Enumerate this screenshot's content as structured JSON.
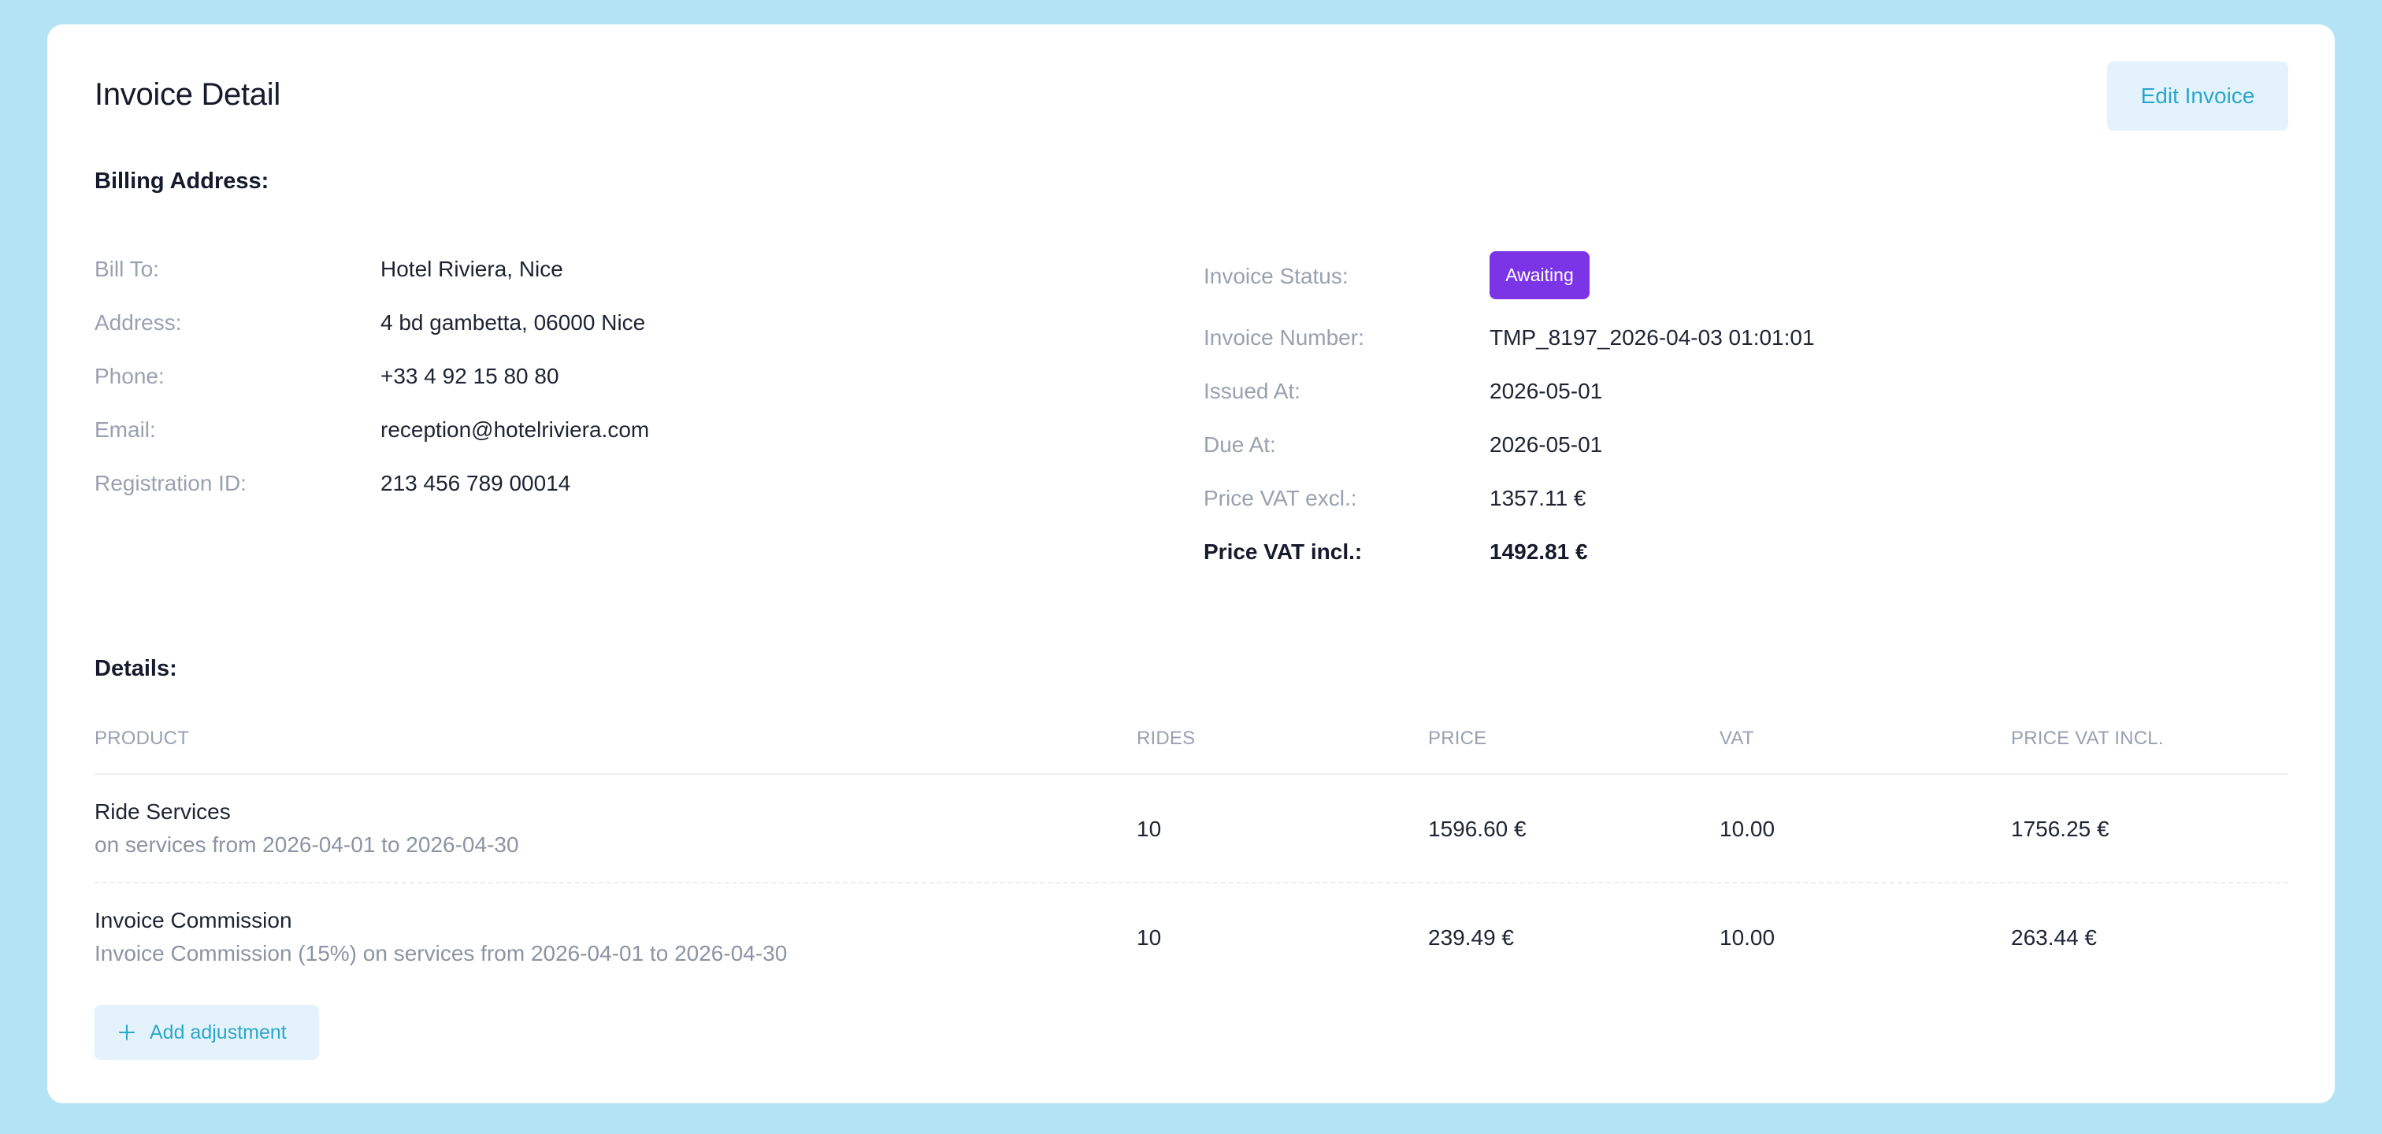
{
  "header": {
    "title": "Invoice Detail",
    "edit_label": "Edit Invoice"
  },
  "billing": {
    "heading": "Billing Address:",
    "rows": [
      {
        "label": "Bill To:",
        "value": "Hotel Riviera, Nice"
      },
      {
        "label": "Address:",
        "value": "4 bd gambetta, 06000 Nice"
      },
      {
        "label": "Phone:",
        "value": "+33 4 92 15 80 80"
      },
      {
        "label": "Email:",
        "value": "reception@hotelriviera.com"
      },
      {
        "label": "Registration ID:",
        "value": "213 456 789 00014"
      }
    ]
  },
  "invoice": {
    "status_label": "Invoice Status:",
    "status_value": "Awaiting",
    "status_color": "#7b35e6",
    "rows": [
      {
        "label": "Invoice Number:",
        "value": "TMP_8197_2026-04-03 01:01:01"
      },
      {
        "label": "Issued At:",
        "value": "2026-05-01"
      },
      {
        "label": "Due At:",
        "value": "2026-05-01"
      },
      {
        "label": "Price VAT excl.:",
        "value": "1357.11 €"
      },
      {
        "label": "Price VAT incl.:",
        "value": "1492.81 €"
      }
    ]
  },
  "details": {
    "heading": "Details:",
    "columns": [
      "PRODUCT",
      "RIDES",
      "PRICE",
      "VAT",
      "PRICE VAT INCL."
    ],
    "rows": [
      {
        "product": "Ride Services",
        "description": "on services from 2026-04-01 to 2026-04-30",
        "rides": "10",
        "price": "1596.60 €",
        "vat": "10.00",
        "price_vat_incl": "1756.25 €"
      },
      {
        "product": "Invoice Commission",
        "description": "Invoice Commission (15%) on services from 2026-04-01 to 2026-04-30",
        "rides": "10",
        "price": "239.49 €",
        "vat": "10.00",
        "price_vat_incl": "263.44 €"
      }
    ],
    "add_label": "Add adjustment"
  },
  "colors": {
    "background": "#b3e3f4",
    "accent": "#2ba6cb",
    "button_bg": "#e4f3fb",
    "muted_text": "#9aa0b0"
  },
  "icons": {
    "add": "plus-icon"
  }
}
